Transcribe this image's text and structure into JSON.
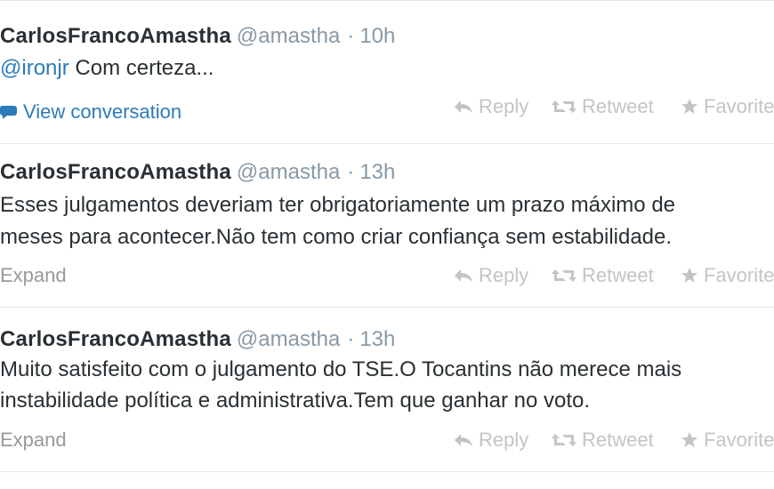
{
  "tweets": [
    {
      "name": "CarlosFrancoAmastha",
      "handle": "@amastha",
      "separator": "·",
      "time": "10h",
      "mention": "@ironjr",
      "text_after_mention": " Com certeza...",
      "footer_link": "View conversation",
      "actions": {
        "reply": "Reply",
        "retweet": "Retweet",
        "favorite": "Favorite"
      }
    },
    {
      "name": "CarlosFrancoAmastha",
      "handle": "@amastha",
      "separator": "·",
      "time": "13h",
      "text_line1": "Esses julgamentos deveriam ter obrigatoriamente um prazo máximo de",
      "text_line2": "meses para acontecer.Não tem como criar confiança sem estabilidade.",
      "footer_link": "Expand",
      "actions": {
        "reply": "Reply",
        "retweet": "Retweet",
        "favorite": "Favorite"
      }
    },
    {
      "name": "CarlosFrancoAmastha",
      "handle": "@amastha",
      "separator": "·",
      "time": "13h",
      "text_line1": "Muito satisfeito com o julgamento do TSE.O Tocantins não merece mais",
      "text_line2": "instabilidade política e administrativa.Tem que ganhar no voto.",
      "footer_link": "Expand",
      "actions": {
        "reply": "Reply",
        "retweet": "Retweet",
        "favorite": "Favorite"
      }
    }
  ],
  "colors": {
    "link": "#2b7bb9",
    "muted": "#8899a6",
    "action": "#c4c4c4",
    "text": "#292f33"
  },
  "icons": {
    "reply": "reply-arrow-icon",
    "retweet": "retweet-arrows-icon",
    "favorite": "star-icon",
    "conversation": "speech-bubble-icon"
  }
}
